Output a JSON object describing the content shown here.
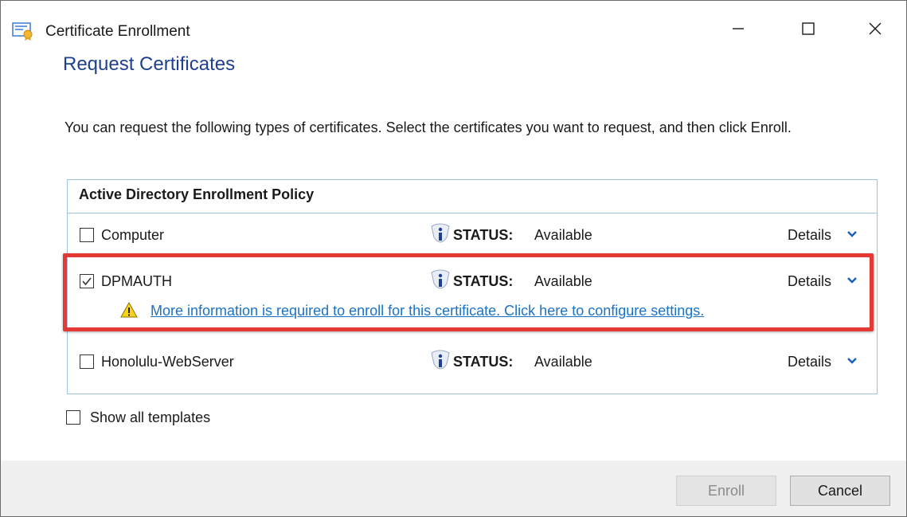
{
  "window": {
    "title": "Certificate Enrollment",
    "app_icon": "certificate-icon"
  },
  "page": {
    "heading": "Request Certificates",
    "intro": "You can request the following types of certificates. Select the certificates you want to request, and then click Enroll."
  },
  "policy": {
    "header": "Active Directory Enrollment Policy",
    "certificates": [
      {
        "name": "Computer",
        "checked": false,
        "status_label": "STATUS:",
        "status_value": "Available",
        "details_label": "Details"
      },
      {
        "name": "DPMAUTH",
        "checked": true,
        "status_label": "STATUS:",
        "status_value": "Available",
        "details_label": "Details",
        "warning": "More information is required to enroll for this certificate. Click here to configure settings."
      },
      {
        "name": "Honolulu-WebServer",
        "checked": false,
        "status_label": "STATUS:",
        "status_value": "Available",
        "details_label": "Details"
      }
    ]
  },
  "options": {
    "show_all_templates": "Show all templates",
    "show_all_checked": false
  },
  "buttons": {
    "enroll": "Enroll",
    "cancel": "Cancel"
  },
  "colors": {
    "heading": "#1f3f8f",
    "link": "#1a73c8",
    "policy_border": "#9fc3e6",
    "highlight": "#e53935",
    "footer_bg": "#f0f0f0"
  }
}
